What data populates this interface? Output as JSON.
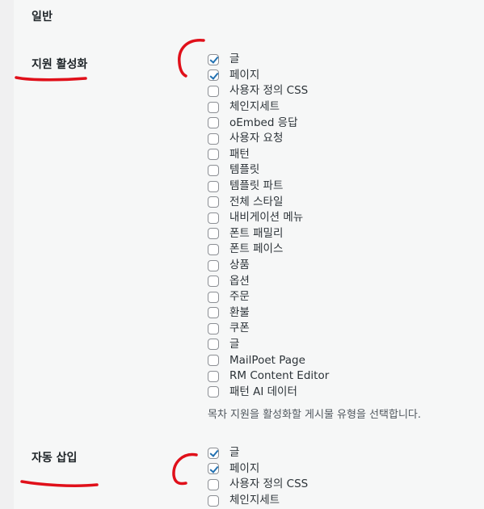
{
  "section": {
    "title": "일반"
  },
  "support": {
    "label": "지원 활성화",
    "items": [
      {
        "label": "글",
        "checked": true
      },
      {
        "label": "페이지",
        "checked": true
      },
      {
        "label": "사용자 정의 CSS",
        "checked": false
      },
      {
        "label": "체인지세트",
        "checked": false
      },
      {
        "label": "oEmbed 응답",
        "checked": false
      },
      {
        "label": "사용자 요청",
        "checked": false
      },
      {
        "label": "패턴",
        "checked": false
      },
      {
        "label": "템플릿",
        "checked": false
      },
      {
        "label": "템플릿 파트",
        "checked": false
      },
      {
        "label": "전체 스타일",
        "checked": false
      },
      {
        "label": "내비게이션 메뉴",
        "checked": false
      },
      {
        "label": "폰트 패밀리",
        "checked": false
      },
      {
        "label": "폰트 페이스",
        "checked": false
      },
      {
        "label": "상품",
        "checked": false
      },
      {
        "label": "옵션",
        "checked": false
      },
      {
        "label": "주문",
        "checked": false
      },
      {
        "label": "환불",
        "checked": false
      },
      {
        "label": "쿠폰",
        "checked": false
      },
      {
        "label": "글",
        "checked": false
      },
      {
        "label": "MailPoet Page",
        "checked": false
      },
      {
        "label": "RM Content Editor",
        "checked": false
      },
      {
        "label": "패턴 AI 데이터",
        "checked": false
      }
    ],
    "description": "목차 지원을 활성화할 게시물 유형을 선택합니다."
  },
  "auto_insert": {
    "label": "자동 삽입",
    "items": [
      {
        "label": "글",
        "checked": true
      },
      {
        "label": "페이지",
        "checked": true
      },
      {
        "label": "사용자 정의 CSS",
        "checked": false
      },
      {
        "label": "체인지세트",
        "checked": false
      }
    ]
  },
  "annotations": {
    "color": "#e0101a"
  }
}
